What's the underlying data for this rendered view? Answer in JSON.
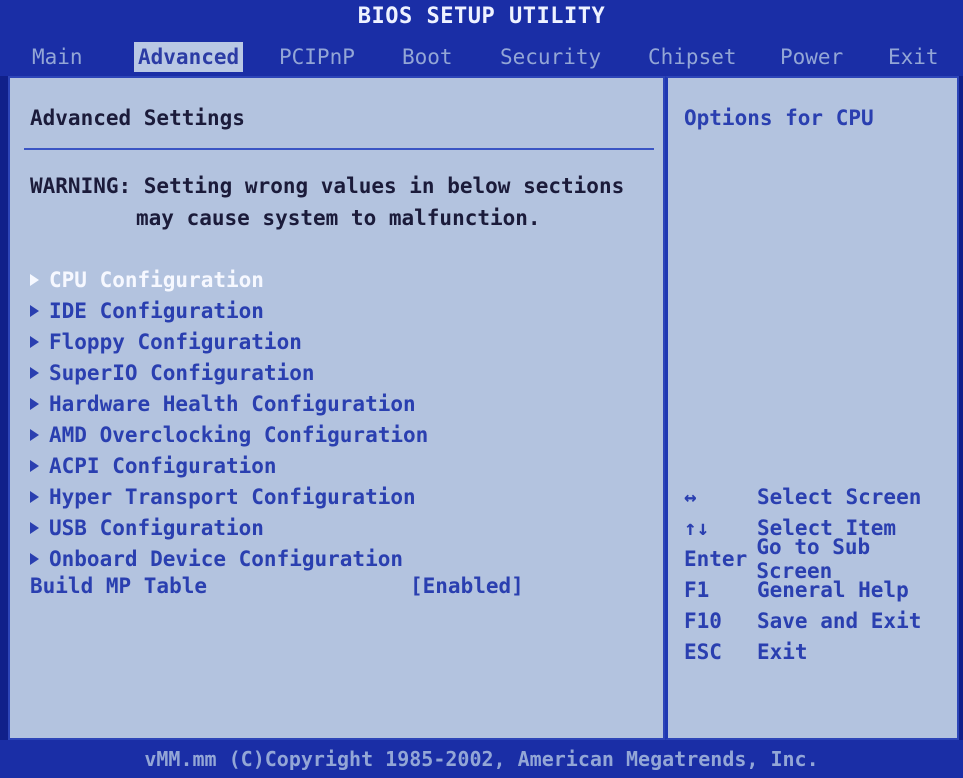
{
  "title": "BIOS SETUP UTILITY",
  "menu": [
    {
      "label": "Main"
    },
    {
      "label": "Advanced"
    },
    {
      "label": "PCIPnP"
    },
    {
      "label": "Boot"
    },
    {
      "label": "Security"
    },
    {
      "label": "Chipset"
    },
    {
      "label": "Power"
    },
    {
      "label": "Exit"
    }
  ],
  "panel_title": "Advanced Settings",
  "warning": {
    "line1": "WARNING: Setting wrong values in below sections",
    "line2": "may cause system to malfunction."
  },
  "items": [
    {
      "label": "CPU Configuration"
    },
    {
      "label": "IDE Configuration"
    },
    {
      "label": "Floppy Configuration"
    },
    {
      "label": "SuperIO Configuration"
    },
    {
      "label": "Hardware Health Configuration"
    },
    {
      "label": "AMD Overclocking Configuration"
    },
    {
      "label": "ACPI Configuration"
    },
    {
      "label": "Hyper Transport Configuration"
    },
    {
      "label": "USB Configuration"
    },
    {
      "label": "Onboard Device Configuration"
    }
  ],
  "build_mp": {
    "label": "Build MP Table",
    "value": "[Enabled]"
  },
  "help": {
    "title": "Options for CPU"
  },
  "keys": [
    {
      "key": "↔",
      "desc": "Select Screen"
    },
    {
      "key": "↑↓",
      "desc": "Select Item"
    },
    {
      "key": "Enter",
      "desc": "Go to Sub Screen"
    },
    {
      "key": "F1",
      "desc": "General Help"
    },
    {
      "key": "F10",
      "desc": "Save and Exit"
    },
    {
      "key": "ESC",
      "desc": "Exit"
    }
  ],
  "footer": "vMM.mm (C)Copyright 1985-2002, American Megatrends, Inc.",
  "colors": {
    "background": "#10208a",
    "panel": "#b3c3df",
    "highlight_text": "#f6f8ff",
    "item_text": "#2a3fb0"
  }
}
